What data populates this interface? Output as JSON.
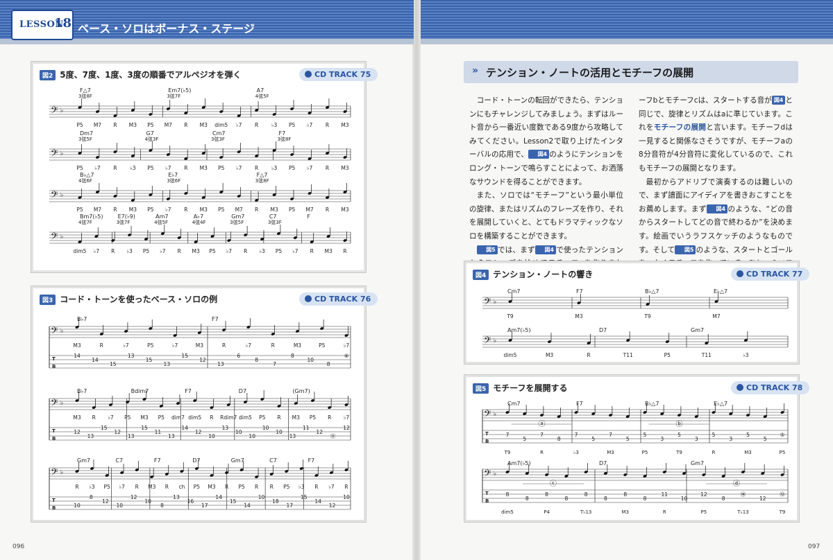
{
  "header": {
    "lesson_label": "LESSON",
    "lesson_number": "18",
    "chapter_title": "ベース・ソロはボーナス・ステージ"
  },
  "fig2": {
    "tag": "図2",
    "title": "5度、7度、1度、3度の順番でアルペジオを弾く",
    "cd_track": "CD TRACK 75",
    "rows": [
      {
        "chords": [
          {
            "name": "F△7",
            "pos": "3弦8F"
          },
          {
            "name": "Em7(♭5)",
            "pos": "3弦7F"
          },
          {
            "name": "A7",
            "pos": "4弦5F"
          }
        ],
        "degrees": [
          "P5",
          "M7",
          "R",
          "M3",
          "P5",
          "M7",
          "R",
          "M3",
          "dim5",
          "♭7",
          "R",
          "♭3",
          "P5",
          "♭7",
          "R",
          "M3"
        ]
      },
      {
        "chords": [
          {
            "name": "Dm7",
            "pos": "3弦5F"
          },
          {
            "name": "G7",
            "pos": "4弦3F"
          },
          {
            "name": "Cm7",
            "pos": "3弦3F"
          },
          {
            "name": "F7",
            "pos": "3弦8F"
          }
        ],
        "degrees": [
          "P5",
          "♭7",
          "R",
          "♭3",
          "P5",
          "♭7",
          "R",
          "M3",
          "P5",
          "♭7",
          "R",
          "♭3",
          "P5",
          "♭7",
          "R",
          "M3"
        ]
      },
      {
        "chords": [
          {
            "name": "B♭△7",
            "pos": "4弦6F"
          },
          {
            "name": "E♭7",
            "pos": "3弦6F"
          },
          {
            "name": "F△7",
            "pos": "3弦8F"
          }
        ],
        "degrees": [
          "P5",
          "M7",
          "R",
          "M3",
          "P5",
          "♭7",
          "R",
          "M3",
          "P5",
          "M7",
          "R",
          "M3",
          "P5",
          "M7",
          "R",
          "M3"
        ]
      },
      {
        "chords": [
          {
            "name": "Bm7(♭5)",
            "pos": "4弦7F"
          },
          {
            "name": "E7(♭9)",
            "pos": "3弦7F"
          },
          {
            "name": "Am7",
            "pos": "4弦5F"
          },
          {
            "name": "A♭7",
            "pos": "4弦4F"
          },
          {
            "name": "Gm7",
            "pos": "3弦5F"
          },
          {
            "name": "C7",
            "pos": "3弦3F"
          },
          {
            "name": "F",
            "pos": ""
          }
        ],
        "degrees": [
          "dim5",
          "♭7",
          "R",
          "♭3",
          "P5",
          "♭7",
          "R",
          "M3",
          "P5",
          "♭7",
          "R",
          "♭3",
          "P5",
          "♭7",
          "R",
          "M3",
          "R"
        ]
      }
    ]
  },
  "fig3": {
    "tag": "図3",
    "title": "コード・トーンを使ったベース・ソロの例",
    "cd_track": "CD TRACK 76",
    "systems": [
      {
        "chords": [
          "B♭7",
          "F7"
        ],
        "degrees": [
          "M3",
          "R",
          "♭7",
          "P5",
          "♭7",
          "M3",
          "R",
          "♭7",
          "R",
          "M3",
          "P5",
          "♭7"
        ],
        "tab": [
          "14",
          "14",
          "15",
          "13",
          "15",
          "13",
          "15",
          "12",
          "13",
          "6",
          "8",
          "7",
          "8",
          "10",
          "8",
          "⑧"
        ]
      },
      {
        "chords": [
          "B♭7",
          "Bdim7",
          "F7",
          "D7",
          "(Gm7)"
        ],
        "degrees": [
          "M3",
          "R",
          "♭7",
          "P5",
          "M3",
          "P5",
          "dim7",
          "dim5",
          "R",
          "Rdim7",
          "dim5",
          "P5",
          "R",
          "M3",
          "P5",
          "R",
          "♭7"
        ],
        "tab": [
          "12",
          "13",
          "15",
          "12",
          "13",
          "15",
          "11",
          "13",
          "14",
          "12",
          "10",
          "13",
          "10",
          "10",
          "10",
          "10",
          "13",
          "11",
          "12",
          "⑪",
          "12"
        ]
      },
      {
        "chords": [
          "Gm7",
          "C7",
          "F7",
          "D7",
          "Gm7",
          "C7",
          "F7"
        ],
        "degrees": [
          "R",
          "♭3",
          "P5",
          "♭7",
          "R",
          "M3",
          "R",
          "ch",
          "P5",
          "M3",
          "R",
          "P5",
          "R",
          "R",
          "P5",
          "♭3",
          "R",
          "♭7",
          "R"
        ],
        "tab": [
          "10",
          "8",
          "12",
          "10",
          "12",
          "10",
          "8",
          "13",
          "16",
          "17",
          "14",
          "15",
          "14",
          "10",
          "18",
          "17",
          "15",
          "14",
          "12",
          "10"
        ]
      }
    ]
  },
  "section": {
    "title": "テンション・ノートの活用とモチーフの展開"
  },
  "body": {
    "col1": [
      "コード・トーンの転回ができたら、テンションにもチャレンジしてみましょう。まずはルート音から一番近い度数である9度から攻略してみてください。Lesson2で取り上げたインターバルの応用で、",
      "のようにテンションをロング・トーンで鳴らすことによって、お洒落なサウンドを得ることができます。",
      "また、ソロでは“モチーフ”という最小単位の旋律、またはリズムのフレーズを作り、それを展開していくと、とてもドラマティックなソロを構築することができます。",
      "では、まず",
      "で使ったテンションからフレーズを始めてモチーフaを作りました。モチ"
    ],
    "col2": [
      "ーフbとモチーフcは、スタートする音が",
      "と同じで、旋律とリズムはaに準じています。これを",
      "モチーフの展開",
      "と言います。モチーフdは一見すると関係なさそうですが、モチーフaの8分音符が4分音符に変化しているので、これもモチーフの展開となります。",
      "最初からアドリブで演奏するのは難しいので、まず譜面にアイディアを書きおこすことをお薦めします。まず",
      "のような、“どの音からスタートしてどの音で終わるか”を決めます。絵画でいうラフスケッチのようなものです。そして",
      "のような、スタートとゴールをつなぐモチーフを作っていき、ひとつのソロを完成させましょう。"
    ],
    "refs": {
      "fig4": "図4",
      "fig5": "図5"
    }
  },
  "fig4": {
    "tag": "図4",
    "title": "テンション・ノートの響き",
    "cd_track": "CD TRACK 77",
    "rows": [
      {
        "chords": [
          "Cm7",
          "F7",
          "B♭△7",
          "E♭△7"
        ],
        "degrees": [
          "T9",
          "M3",
          "T9",
          "M7"
        ]
      },
      {
        "chords": [
          "Am7(♭5)",
          "D7",
          "Gm7"
        ],
        "degrees": [
          "dim5",
          "M3",
          "R",
          "T11",
          "P5",
          "T11",
          "♭3"
        ]
      }
    ]
  },
  "fig5": {
    "tag": "図5",
    "title": "モチーフを展開する",
    "cd_track": "CD TRACK 78",
    "rows": [
      {
        "chords": [
          "Cm7",
          "F7",
          "B♭△7",
          "E♭△7"
        ],
        "motifs": [
          "ⓐ",
          "ⓑ"
        ],
        "degrees": [
          "T9",
          "R",
          "♭3",
          "M3",
          "P5",
          "T9",
          "R",
          "M3",
          "P5"
        ],
        "tab": [
          "7",
          "5",
          "7",
          "8",
          "7",
          "5",
          "7",
          "5",
          "5",
          "3",
          "5",
          "3",
          "5",
          "3",
          "5",
          "5",
          "⑤"
        ]
      },
      {
        "chords": [
          "Am7(♭5)",
          "D7",
          "Gm7"
        ],
        "motifs": [
          "ⓒ",
          "ⓓ"
        ],
        "degrees": [
          "dim5",
          "P4",
          "T♭13",
          "M3",
          "R",
          "P5",
          "T♭13",
          "T9"
        ],
        "tab": [
          "8",
          "8",
          "8",
          "8",
          "8",
          "8",
          "8",
          "8",
          "11",
          "10",
          "12",
          "8",
          "⑭",
          "12",
          "⑫"
        ]
      }
    ]
  },
  "page_numbers": {
    "left": "096",
    "right": "097"
  }
}
